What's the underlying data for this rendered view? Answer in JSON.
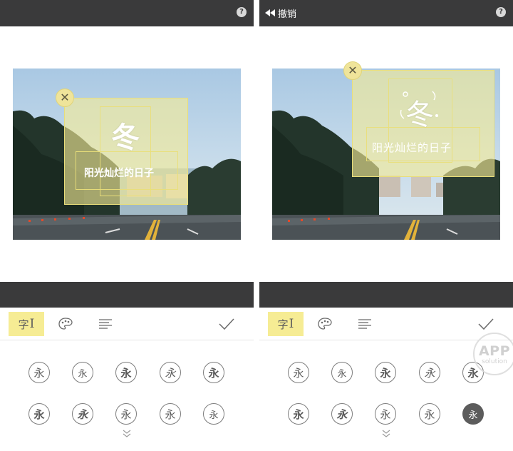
{
  "colors": {
    "dark_bar": "#3a3a3b",
    "highlight_yellow": "#f6ec94",
    "overlay_yellow": "#f6ec96",
    "icon_gray": "#6b6b6b"
  },
  "left_panel": {
    "help_icon_glyph": "?",
    "title_text": "冬",
    "subtitle_text": "阳光灿烂的日子",
    "close_glyph": "✕"
  },
  "right_panel": {
    "undo_label": "撤销",
    "help_icon_glyph": "?",
    "title_text": "冬",
    "subtitle_text": "阳光灿烂的日子",
    "close_glyph": "✕"
  },
  "toolbar": {
    "font_tab_label": "字",
    "font_tab_cursor": "I",
    "icons": [
      "font-tab-icon",
      "palette-icon",
      "align-icon",
      "checkmark-icon"
    ]
  },
  "font_options": {
    "glyphs": [
      "永",
      "永",
      "永",
      "永",
      "永",
      "永",
      "永",
      "永",
      "永",
      "永"
    ],
    "left_selected_index": -1,
    "right_selected_index": 9
  },
  "watermark": {
    "line1": "APP",
    "line2": "solution"
  }
}
